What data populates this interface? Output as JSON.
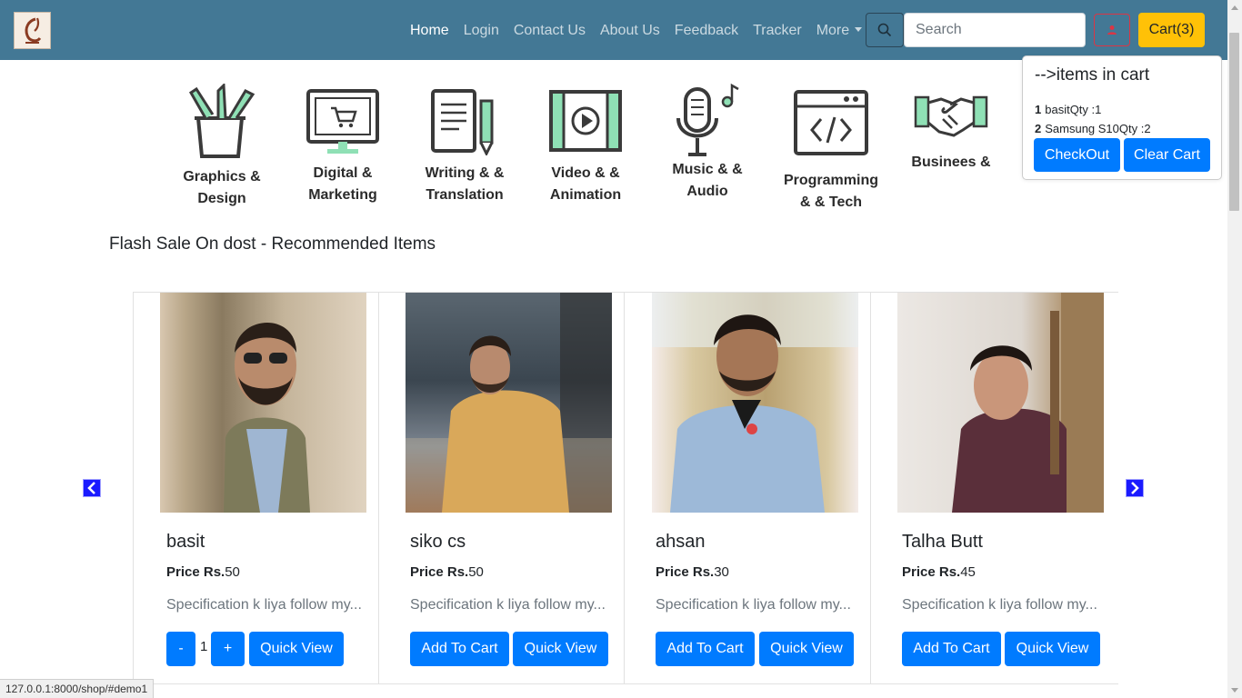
{
  "navbar": {
    "links": [
      {
        "label": "Home",
        "active": true
      },
      {
        "label": "Login"
      },
      {
        "label": "Contact Us"
      },
      {
        "label": "About Us"
      },
      {
        "label": "Feedback"
      },
      {
        "label": "Tracker"
      },
      {
        "label": "More"
      }
    ],
    "search_placeholder": "Search",
    "cart_label": "Cart(3)",
    "colors": {
      "bar": "#437895",
      "cart": "#ffc107",
      "user": "#dc3545"
    }
  },
  "cart_popover": {
    "title": "-->items in cart",
    "items": [
      {
        "index": "1",
        "text": "basitQty :1"
      },
      {
        "index": "2",
        "text": "Samsung S10Qty :2"
      }
    ],
    "checkout_label": "CheckOut",
    "clear_label": "Clear Cart"
  },
  "categories": [
    {
      "line1": "Graphics &",
      "line2": "Design",
      "icon": "pencil-cup-icon"
    },
    {
      "line1": "Digital &",
      "line2": "Marketing",
      "icon": "monitor-cart-icon"
    },
    {
      "line1": "Writing & &",
      "line2": "Translation",
      "icon": "document-pen-icon"
    },
    {
      "line1": "Video & &",
      "line2": "Animation",
      "icon": "film-play-icon"
    },
    {
      "line1": "Music & &",
      "line2": "Audio",
      "icon": "microphone-icon"
    },
    {
      "line1": "Programming",
      "line2": "& & Tech",
      "icon": "code-window-icon"
    },
    {
      "line1": "Businees &",
      "line2": "",
      "icon": "handshake-icon"
    }
  ],
  "section_title": "Flash Sale On dost - Recommended Items",
  "products": [
    {
      "name": "basit",
      "price_label": "Price Rs.",
      "price": "50",
      "desc": "Specification k liya follow my...",
      "qty": "1",
      "minus": "-",
      "plus": "+",
      "quick_view": "Quick View"
    },
    {
      "name": "siko cs",
      "price_label": "Price Rs.",
      "price": "50",
      "desc": "Specification k liya follow my...",
      "add": "Add To Cart",
      "quick_view": "Quick View"
    },
    {
      "name": "ahsan",
      "price_label": "Price Rs.",
      "price": "30",
      "desc": "Specification k liya follow my...",
      "add": "Add To Cart",
      "quick_view": "Quick View"
    },
    {
      "name": "Talha Butt",
      "price_label": "Price Rs.",
      "price": "45",
      "desc": "Specification k liya follow my...",
      "add": "Add To Cart",
      "quick_view": "Quick View"
    }
  ],
  "status_url": "127.0.0.1:8000/shop/#demo1"
}
